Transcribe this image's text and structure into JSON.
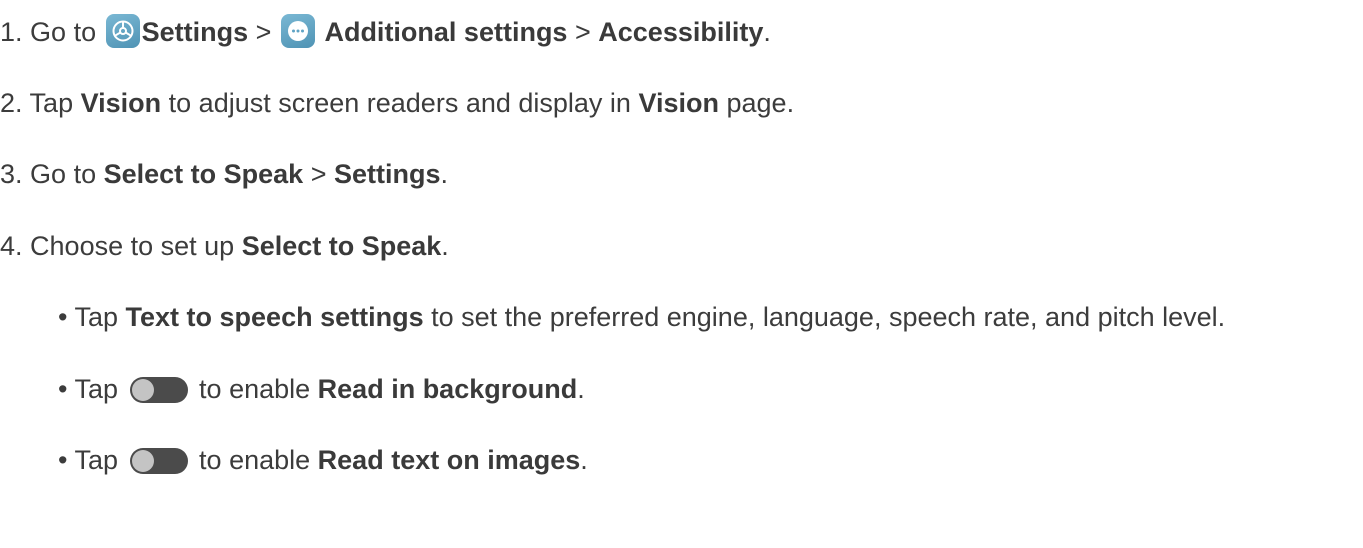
{
  "steps": [
    {
      "num": "1.",
      "pre": "Go to",
      "icon1": "settings-gear-icon",
      "b1": "Settings",
      "sep1": ">",
      "icon2": "more-dots-icon",
      "b2": "Additional settings",
      "sep2": ">",
      "b3": "Accessibility",
      "end": "."
    },
    {
      "num": "2.",
      "pre": "Tap",
      "b1": "Vision",
      "mid": "to adjust screen readers and display in",
      "b2": "Vision",
      "end": "page."
    },
    {
      "num": "3.",
      "pre": "Go to",
      "b1": "Select to Speak",
      "sep": ">",
      "b2": "Settings",
      "end": "."
    },
    {
      "num": "4.",
      "pre": "Choose to set up",
      "b1": "Select to Speak",
      "end": "."
    }
  ],
  "bullets": [
    {
      "marker": "•",
      "pre": "Tap",
      "b1": "Text to speech settings",
      "end": "to set the preferred engine, language, speech rate, and pitch level."
    },
    {
      "marker": "•",
      "pre": "Tap",
      "icon": "toggle-switch-icon",
      "mid": "to enable",
      "b1": "Read in background",
      "end": "."
    },
    {
      "marker": "•",
      "pre": "Tap",
      "icon": "toggle-switch-icon",
      "mid": "to enable",
      "b1": "Read text on images",
      "end": "."
    }
  ],
  "colors": {
    "text": "#3c3c3c",
    "icon_bg": "#5fa3c4",
    "toggle_track": "#4b4b4b",
    "toggle_knob": "#c4c4c4"
  }
}
